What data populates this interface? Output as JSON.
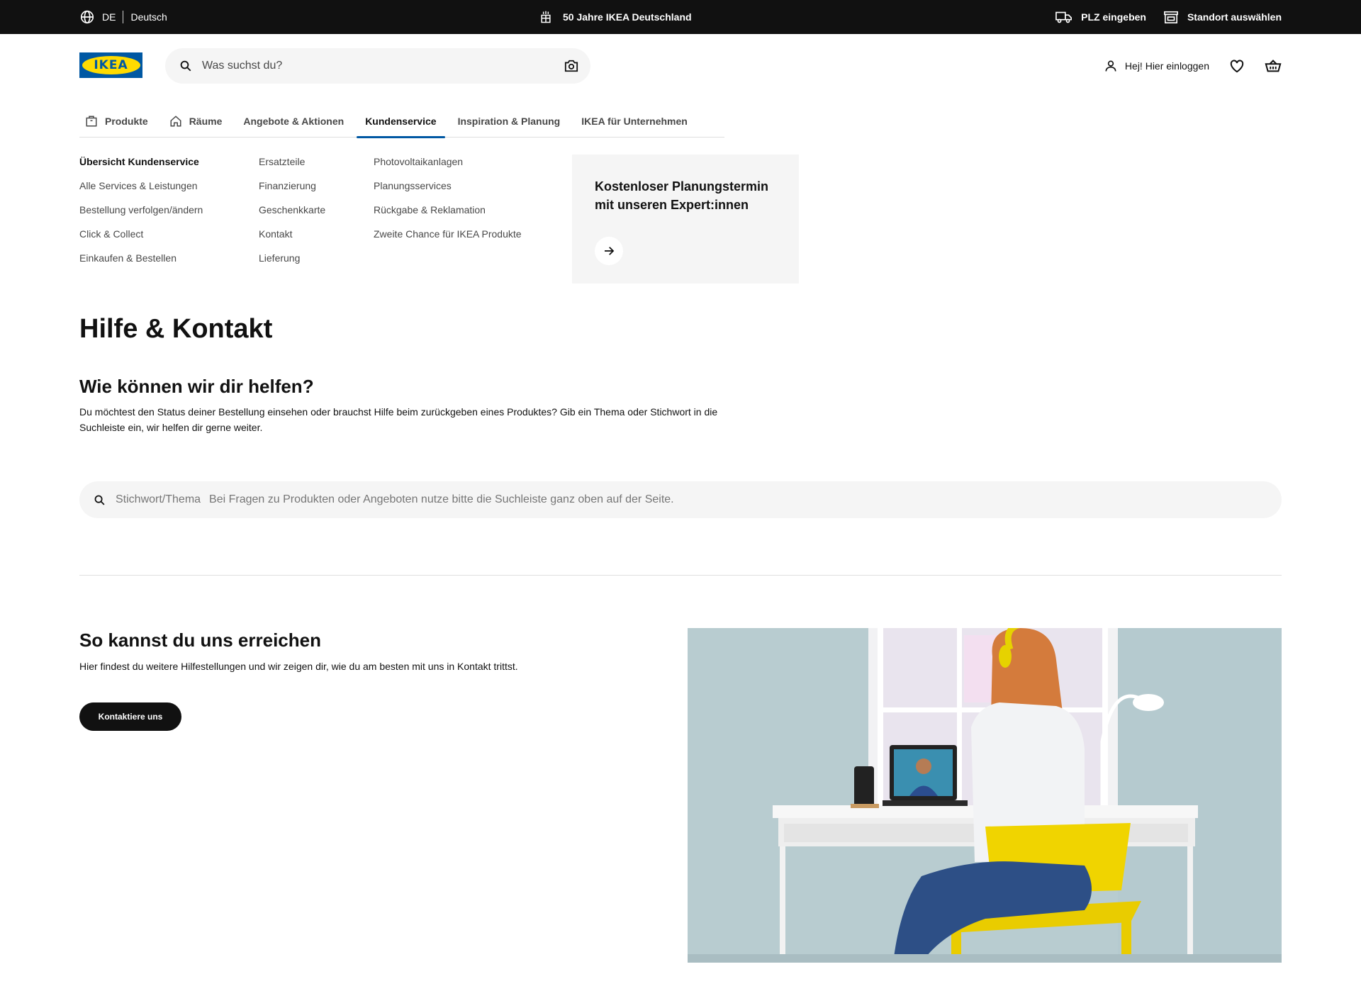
{
  "topbar": {
    "lang_code": "DE",
    "lang_name": "Deutsch",
    "promo": "50 Jahre IKEA Deutschland",
    "plz": "PLZ eingeben",
    "store": "Standort auswählen"
  },
  "header": {
    "logo_text": "IKEA",
    "search_placeholder": "Was suchst du?",
    "login": "Hej! Hier einloggen"
  },
  "nav": {
    "items": [
      {
        "label": "Produkte"
      },
      {
        "label": "Räume"
      },
      {
        "label": "Angebote & Aktionen"
      },
      {
        "label": "Kundenservice"
      },
      {
        "label": "Inspiration & Planung"
      },
      {
        "label": "IKEA für Unternehmen"
      }
    ]
  },
  "subnav": {
    "col1": [
      "Übersicht Kundenservice",
      "Alle Services & Leistungen",
      "Bestellung verfolgen/ändern",
      "Click & Collect",
      "Einkaufen & Bestellen"
    ],
    "col2": [
      "Ersatzteile",
      "Finanzierung",
      "Geschenkkarte",
      "Kontakt",
      "Lieferung"
    ],
    "col3": [
      "Photovoltaikanlagen",
      "Planungsservices",
      "Rückgabe & Reklamation",
      "Zweite Chance für IKEA Produkte"
    ],
    "promo_title": "Kostenloser Planungstermin mit unseren Expert:innen"
  },
  "main": {
    "title": "Hilfe & Kontakt",
    "help_title": "Wie können wir dir helfen?",
    "help_text": "Du möchtest den Status deiner Bestellung einsehen oder brauchst Hilfe beim zurückgeben eines Produktes? Gib ein Thema oder Stichwort in die Suchleiste ein, wir helfen dir gerne weiter.",
    "search_label": "Stichwort/Thema",
    "search_placeholder": "Bei Fragen zu Produkten oder Angeboten nutze bitte die Suchleiste ganz oben auf der Seite.",
    "reach_title": "So kannst du uns erreichen",
    "reach_text": "Hier findest du weitere Hilfestellungen und wir zeigen dir, wie du am besten mit uns in Kontakt trittst.",
    "contact_button": "Kontaktiere uns"
  },
  "colors": {
    "brand_blue": "#0058a3",
    "brand_yellow": "#ffdb00",
    "topbar_bg": "#111111",
    "search_bg": "#f5f5f5"
  }
}
